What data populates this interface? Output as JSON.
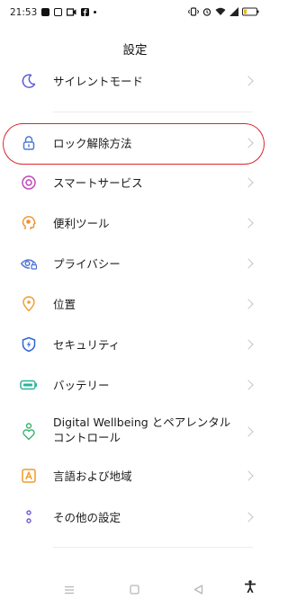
{
  "status_bar": {
    "time": "21:53",
    "battery": "10"
  },
  "header": {
    "title": "設定"
  },
  "items": [
    {
      "label": "サイレントモード",
      "icon": "moon-icon",
      "color": "#5b5bd6"
    },
    {
      "label": "ロック解除方法",
      "icon": "lock-icon",
      "color": "#4a7bd6",
      "highlighted": true
    },
    {
      "label": "スマートサービス",
      "icon": "target-circle-icon",
      "color": "#c04bb8"
    },
    {
      "label": "便利ツール",
      "icon": "tools-head-icon",
      "color": "#f0902a"
    },
    {
      "label": "プライバシー",
      "icon": "privacy-eye-icon",
      "color": "#4a6fd6"
    },
    {
      "label": "位置",
      "icon": "location-pin-icon",
      "color": "#f0a030"
    },
    {
      "label": "セキュリティ",
      "icon": "shield-bolt-icon",
      "color": "#2f66d6"
    },
    {
      "label": "バッテリー",
      "icon": "battery-icon",
      "color": "#2bb39a"
    },
    {
      "label": "Digital Wellbeing とペアレンタル\nコントロール",
      "icon": "wellbeing-heart-icon",
      "color": "#38b36b"
    },
    {
      "label": "言語および地域",
      "icon": "language-a-icon",
      "color": "#f09a2a"
    },
    {
      "label": "その他の設定",
      "icon": "more-dots-icon",
      "color": "#6a5bd6"
    }
  ],
  "highlight_color": "#e0242d"
}
